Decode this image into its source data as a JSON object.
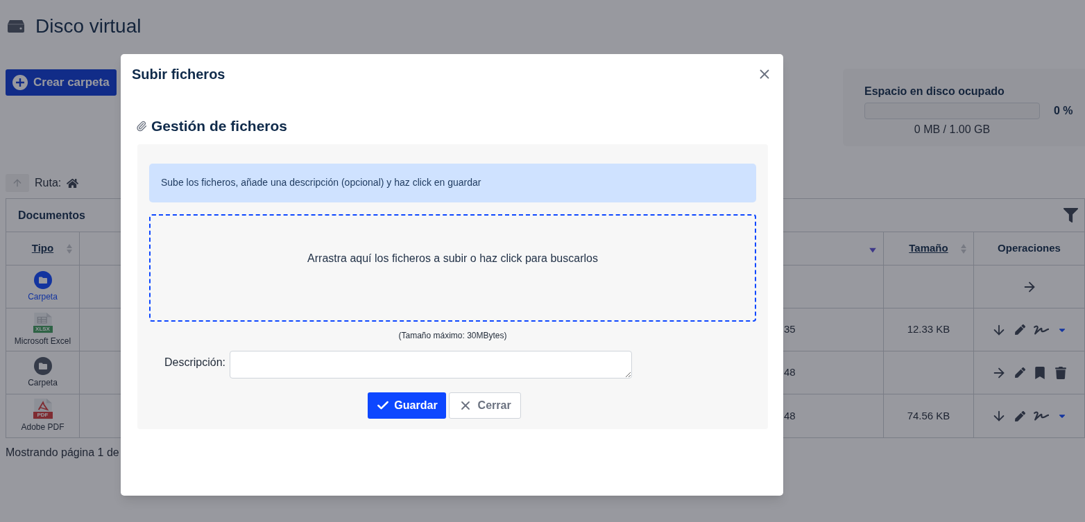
{
  "page": {
    "title": "Disco virtual"
  },
  "create_folder_button": {
    "label": "Crear carpeta"
  },
  "disk_usage": {
    "title": "Espacio en disco ocupado",
    "level": 0,
    "percent": "0 %",
    "usage": "0 MB / 1.00 GB"
  },
  "path": {
    "label": "Ruta:"
  },
  "table": {
    "title": "Documentos",
    "columns": [
      {
        "label": "Tipo",
        "sortable": true,
        "descending": false
      },
      {
        "descending": true
      },
      {
        "label": "Tamaño",
        "sortable": true,
        "descending": false
      },
      {
        "label": "Operaciones",
        "sortable": false,
        "descending": false
      }
    ],
    "rows": [
      {
        "type": {
          "kind": "folder",
          "label": "Carpeta",
          "highlighted": true
        },
        "operations": [
          {
            "kind": "open"
          }
        ]
      },
      {
        "type": {
          "kind": "excel",
          "label": "Microsoft Excel",
          "badge": "XLSX"
        },
        "column_3": "35",
        "size": "12.33 KB",
        "operations": [
          {
            "kind": "download"
          },
          {
            "kind": "edit"
          },
          {
            "kind": "sign"
          },
          {
            "kind": "more"
          }
        ]
      },
      {
        "type": {
          "kind": "folder",
          "label": "Carpeta",
          "highlighted": false
        },
        "column_3": "48",
        "operations": [
          {
            "kind": "open"
          },
          {
            "kind": "edit"
          },
          {
            "kind": "bookmark"
          },
          {
            "kind": "delete"
          }
        ]
      },
      {
        "type": {
          "kind": "pdf",
          "label": "Adobe PDF",
          "badge": "PDF"
        },
        "column_3": "48",
        "size": "74.56 KB",
        "operations": [
          {
            "kind": "download"
          },
          {
            "kind": "edit"
          },
          {
            "kind": "sign"
          },
          {
            "kind": "more"
          }
        ]
      }
    ]
  },
  "footer": "Mostrando página 1 de",
  "modal": {
    "title": "Subir ficheros",
    "section_title": "Gestión de ficheros",
    "info": "Sube los ficheros, añade una descripción (opcional) y haz click en guardar",
    "dropzone": "Arrastra aquí los ficheros a subir o haz click para buscarlos",
    "hint": "(Tamaño máximo: 30MBytes)",
    "description_label": "Descripción:",
    "buttons": [
      {
        "kind": "primary",
        "label": "Guardar"
      },
      {
        "kind": "secondary",
        "label": "Cerrar"
      }
    ]
  }
}
